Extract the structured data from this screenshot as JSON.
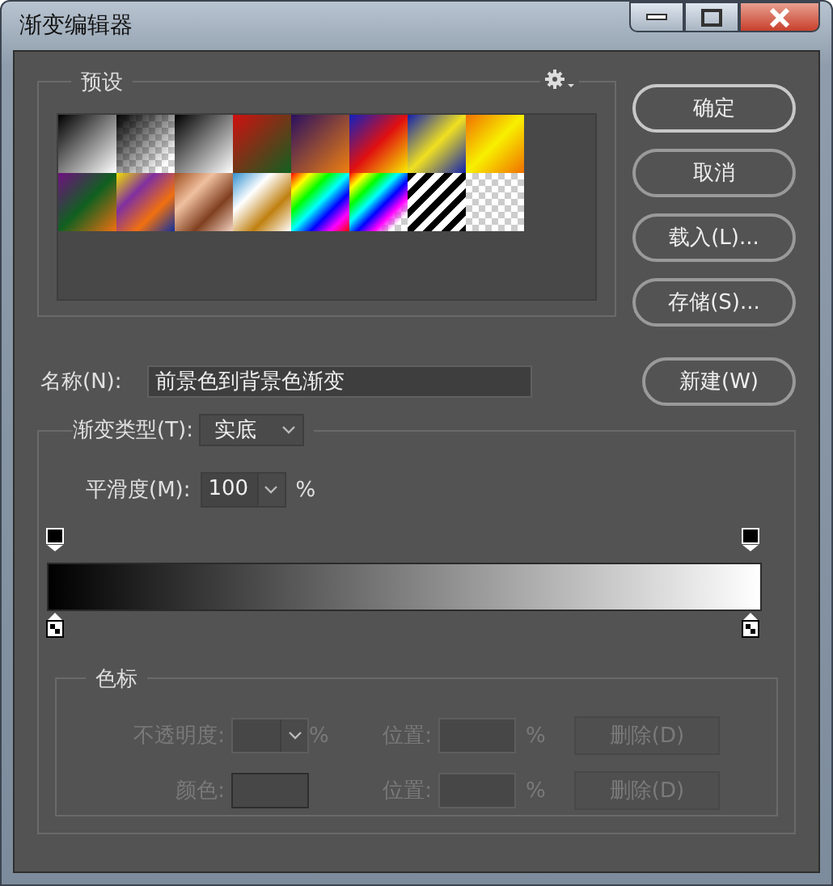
{
  "window": {
    "title": "渐变编辑器"
  },
  "presets": {
    "label": "预设"
  },
  "buttons": [
    "确定",
    "取消",
    "载入(L)...",
    "存储(S)..."
  ],
  "name": {
    "label": "名称(N):",
    "value": "前景色到背景色渐变",
    "button": "新建(W)"
  },
  "gradient": {
    "type_label": "渐变类型(T):",
    "type_value": "实底",
    "smooth_label": "平滑度(M):",
    "smooth_value": "100",
    "smooth_unit": "%"
  },
  "stops": {
    "label": "色标",
    "disabled": true,
    "rows": [
      {
        "label": "不透明度:",
        "kind": "opacity",
        "unit": "%",
        "position_label": "位置:",
        "position_unit": "%",
        "delete": "删除(D)"
      },
      {
        "label": "颜色:",
        "kind": "color",
        "position_label": "位置:",
        "position_unit": "%",
        "delete": "删除(D)"
      }
    ]
  }
}
